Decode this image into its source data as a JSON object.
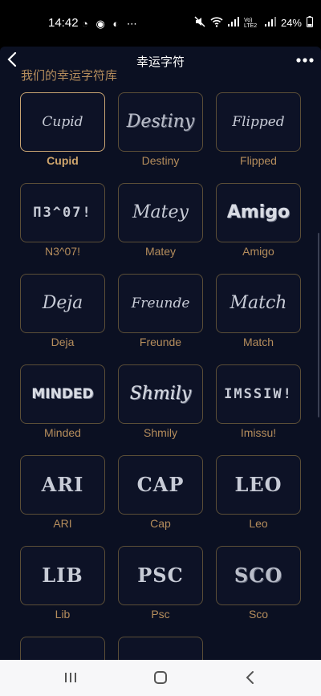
{
  "status": {
    "time": "14:42",
    "left_icons": "◔ ◉ ◐ ⋯",
    "battery": "24%",
    "network": "Vo) LTE2"
  },
  "header": {
    "title": "幸运字符",
    "back_icon": "chevron-left-icon",
    "more_icon": "more-horizontal-icon"
  },
  "section": {
    "title": "我们的幸运字符库"
  },
  "items": [
    {
      "name": "Cupid",
      "art": "Cupid",
      "style": "script sm",
      "selected": true
    },
    {
      "name": "Destiny",
      "art": "Destiny",
      "style": "script sketch"
    },
    {
      "name": "Flipped",
      "art": "Flipped",
      "style": "script sm"
    },
    {
      "name": "N3^07!",
      "art": "Π3^07!",
      "style": "mono"
    },
    {
      "name": "Matey",
      "art": "Matey",
      "style": "script"
    },
    {
      "name": "Amigo",
      "art": "Amigo",
      "style": "blocky outline"
    },
    {
      "name": "Deja",
      "art": "Deja",
      "style": "script"
    },
    {
      "name": "Freunde",
      "art": "Freunde",
      "style": "script sm"
    },
    {
      "name": "Match",
      "art": "Match",
      "style": "script"
    },
    {
      "name": "Minded",
      "art": "MINDED",
      "style": "blocky sm outline"
    },
    {
      "name": "Shmily",
      "art": "Shmily",
      "style": "script outline"
    },
    {
      "name": "Imissu!",
      "art": "IMSSIW!",
      "style": "mono"
    },
    {
      "name": "ARI",
      "art": "ARI",
      "style": "serif"
    },
    {
      "name": "Cap",
      "art": "CAP",
      "style": "serif"
    },
    {
      "name": "Leo",
      "art": "LEO",
      "style": "serif"
    },
    {
      "name": "Lib",
      "art": "LIB",
      "style": "serif"
    },
    {
      "name": "Psc",
      "art": "PSC",
      "style": "serif"
    },
    {
      "name": "Sco",
      "art": "SCO",
      "style": "serif sketch"
    },
    {
      "name": "",
      "art": "",
      "style": "serif"
    },
    {
      "name": "",
      "art": "",
      "style": "script"
    }
  ],
  "colors": {
    "background": "#0b1022",
    "accent": "#b58d5c",
    "card_border": "#5b4e37",
    "glyph": "#c7cbd6"
  },
  "nav": {
    "recent_icon": "recent-apps-icon",
    "home_icon": "home-icon",
    "back_icon": "back-icon"
  }
}
